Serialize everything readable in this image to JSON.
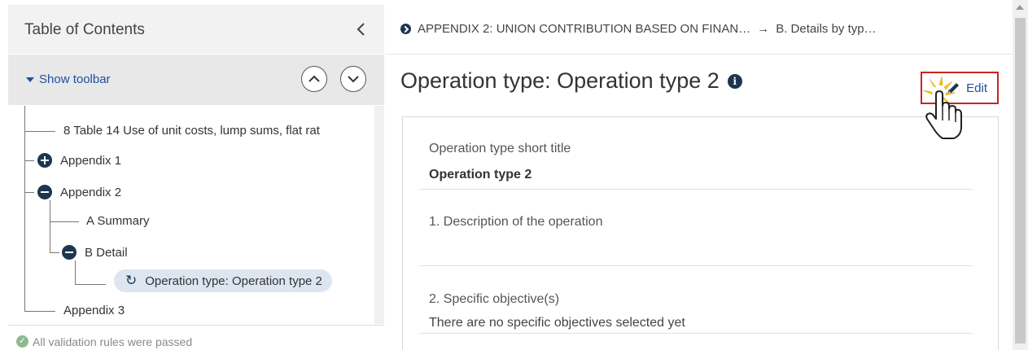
{
  "toc": {
    "title": "Table of Contents",
    "show_toolbar": "Show toolbar",
    "items": [
      {
        "label": "8 Table 14 Use of unit costs, lump sums, flat rat"
      },
      {
        "label": "Appendix 1"
      },
      {
        "label": "Appendix 2"
      },
      {
        "label": "A Summary"
      },
      {
        "label": "B Detail"
      },
      {
        "label": "Operation type: Operation type 2"
      },
      {
        "label": "Appendix 3"
      }
    ],
    "validation": "All validation rules were passed"
  },
  "breadcrumb": {
    "first": "APPENDIX 2: UNION CONTRIBUTION BASED ON FINAN…",
    "arrow": "→",
    "second": "B. Details by typ…"
  },
  "page": {
    "title": "Operation type: Operation type 2",
    "edit_label": "Edit"
  },
  "fields": {
    "short_title_label": "Operation type short title",
    "short_title_value": "Operation type 2",
    "description_label": "1. Description of the operation",
    "objectives_label": "2. Specific objective(s)",
    "objectives_value": "There are no specific objectives selected yet"
  },
  "colors": {
    "accent": "#1d3650",
    "link": "#1f4fa0",
    "highlight": "#cc2222"
  }
}
